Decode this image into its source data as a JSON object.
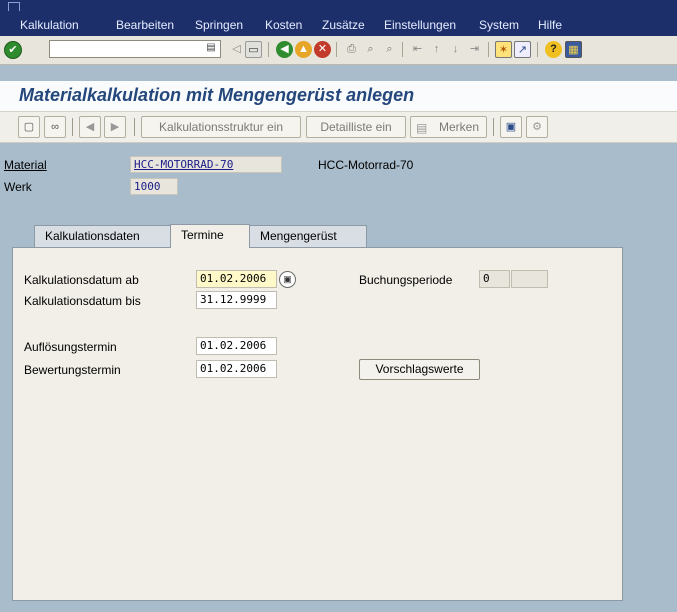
{
  "menubar": {
    "items": [
      "Kalkulation",
      "Bearbeiten",
      "Springen",
      "Kosten",
      "Zusätze",
      "Einstellungen",
      "System",
      "Hilfe"
    ]
  },
  "systool": {
    "command_value": "",
    "icons": [
      "enter-icon",
      "save-icon",
      "back-icon",
      "exit-icon",
      "cancel-icon",
      "print-icon",
      "find-icon",
      "find-next-icon",
      "first-page-icon",
      "prev-page-icon",
      "next-page-icon",
      "last-page-icon",
      "new-session-icon",
      "shortcut-icon",
      "help-icon",
      "layout-icon"
    ]
  },
  "title": "Materialkalkulation mit Mengengerüst anlegen",
  "apptool": {
    "kalkstruktur_label": "Kalkulationsstruktur ein",
    "detailliste_label": "Detailliste ein",
    "merken_label": "Merken"
  },
  "header": {
    "material_label": "Material",
    "material_value": "HCC-MOTORRAD-70",
    "material_desc": "HCC-Motorrad-70",
    "werk_label": "Werk",
    "werk_value": "1000"
  },
  "tabs": [
    {
      "label": "Kalkulationsdaten",
      "active": false
    },
    {
      "label": "Termine",
      "active": true
    },
    {
      "label": "Mengengerüst",
      "active": false
    }
  ],
  "termine": {
    "kalkdatum_ab_label": "Kalkulationsdatum ab",
    "kalkdatum_ab_value": "01.02.2006",
    "kalkdatum_bis_label": "Kalkulationsdatum bis",
    "kalkdatum_bis_value": "31.12.9999",
    "buchungsperiode_label": "Buchungsperiode",
    "buchungsperiode_value": "0",
    "buchungsjahr_value": "",
    "aufloesung_label": "Auflösungstermin",
    "aufloesung_value": "01.02.2006",
    "bewertung_label": "Bewertungstermin",
    "bewertung_value": "01.02.2006",
    "vorschlag_label": "Vorschlagswerte"
  },
  "colors": {
    "menubar_bg": "#1c2f6b",
    "title_color": "#24477c",
    "required_field": "#fff8c8"
  }
}
